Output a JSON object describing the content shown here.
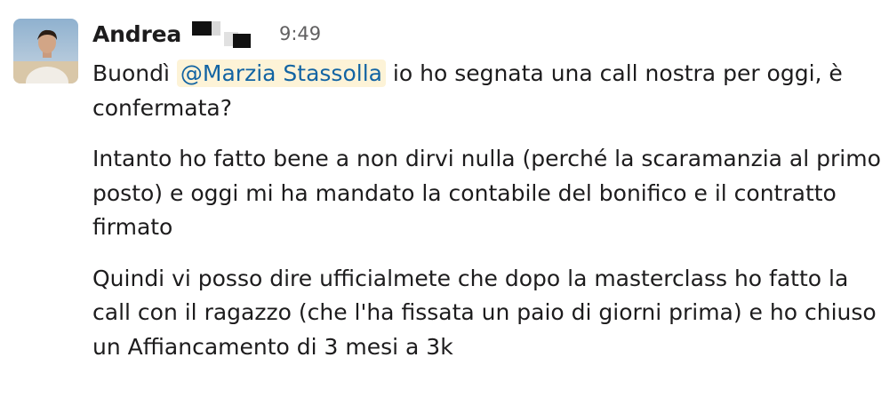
{
  "message": {
    "author": "Andrea",
    "timestamp": "9:49",
    "mention": "@Marzia Stassolla",
    "p1_before": "Buondì ",
    "p1_after": " io ho segnata una call nostra per oggi, è confermata?",
    "p2": "Intanto ho fatto bene a non dirvi nulla (perché la scaramanzia al primo posto) e oggi mi ha mandato la contabile del bonifico e il contratto firmato",
    "p3": "Quindi vi posso dire ufficialmete che dopo la masterclass ho fatto la call con il ragazzo (che l'ha fissata un paio di giorni prima) e ho chiuso un Affiancamento di 3 mesi a 3k"
  },
  "colors": {
    "mention_text": "#1264a3",
    "mention_bg": "#fdf3d7",
    "timestamp": "#616061"
  }
}
